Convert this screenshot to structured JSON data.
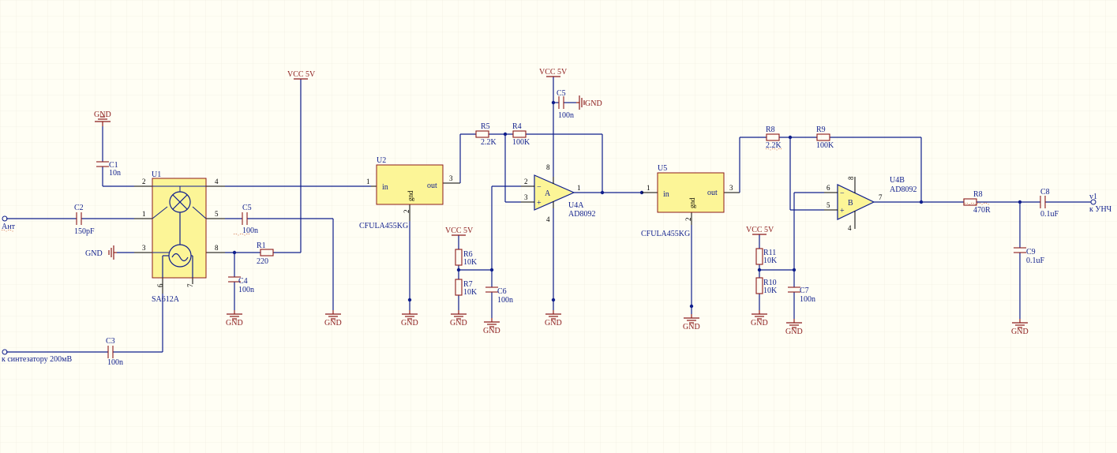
{
  "colors": {
    "wire": "#0f1e8c",
    "power": "#8b1a1a",
    "ic_fill": "#fcf597",
    "background": "#fffef4"
  },
  "ports": {
    "ant": "Ант",
    "synth": "к синтезатору 200мВ",
    "v1": "v1",
    "out": "к УНЧ"
  },
  "power": {
    "vcc": "VCC 5V",
    "gnd": "GND"
  },
  "u1": {
    "ref": "U1",
    "part": "SA612A",
    "pins": [
      "1",
      "2",
      "3",
      "4",
      "5",
      "6",
      "7",
      "8"
    ]
  },
  "u2": {
    "ref": "U2",
    "part": "CFULA455KG",
    "in": "in",
    "out": "out",
    "gnd": "gnd",
    "p1": "1",
    "p2": "2",
    "p3": "3"
  },
  "u5": {
    "ref": "U5",
    "part": "CFULA455KG",
    "in": "in",
    "out": "out",
    "gnd": "gnd",
    "p1": "1",
    "p2": "2",
    "p3": "3"
  },
  "u4a": {
    "ref": "U4A",
    "part": "AD8092",
    "unit": "A",
    "p2": "2",
    "p3": "3",
    "p1": "1",
    "p8": "8",
    "p4": "4"
  },
  "u4b": {
    "ref": "U4B",
    "part": "AD8092",
    "unit": "B",
    "p6": "6",
    "p5": "5",
    "p7": "7",
    "p8": "8",
    "p4": "4"
  },
  "c1": {
    "ref": "C1",
    "value": "10n"
  },
  "c2": {
    "ref": "C2",
    "value": "150pF"
  },
  "c3": {
    "ref": "C3",
    "value": "100n"
  },
  "c4": {
    "ref": "C4",
    "value": "100n"
  },
  "c5a": {
    "ref": "C5",
    "value": "100n"
  },
  "c5b": {
    "ref": "C5",
    "value": "100n"
  },
  "c6": {
    "ref": "C6",
    "value": "100n"
  },
  "c7": {
    "ref": "C7",
    "value": "100n"
  },
  "c8": {
    "ref": "C8",
    "value": "0.1uF"
  },
  "c9": {
    "ref": "C9",
    "value": "0.1uF"
  },
  "r1": {
    "ref": "R1",
    "value": "220"
  },
  "r4": {
    "ref": "R4",
    "value": "100K"
  },
  "r5": {
    "ref": "R5",
    "value": "2.2K"
  },
  "r6": {
    "ref": "R6",
    "value": "10K"
  },
  "r7": {
    "ref": "R7",
    "value": "10K"
  },
  "r8a": {
    "ref": "R8",
    "value": "2.2K"
  },
  "r8b": {
    "ref": "R8",
    "value": "470R"
  },
  "r9": {
    "ref": "R9",
    "value": "100K"
  },
  "r10": {
    "ref": "R10",
    "value": "10K"
  },
  "r11": {
    "ref": "R11",
    "value": "10K"
  }
}
